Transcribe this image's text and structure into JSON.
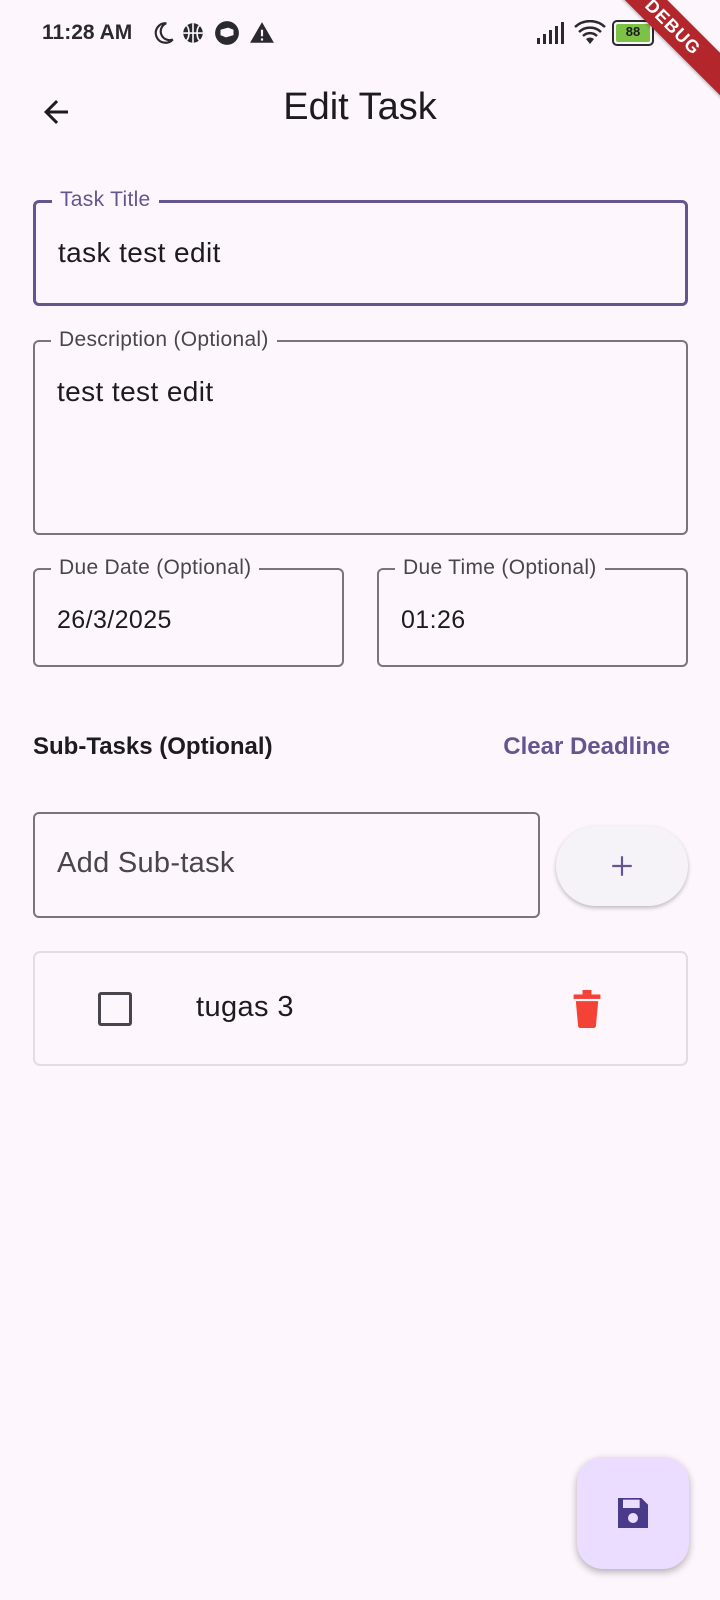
{
  "status_bar": {
    "time": "11:28 AM",
    "battery": "88"
  },
  "debug_banner": "DEBUG",
  "app_bar": {
    "title": "Edit Task",
    "back_icon": "arrow-back-icon"
  },
  "form": {
    "task_title": {
      "label": "Task Title",
      "value": "task test edit"
    },
    "description": {
      "label": "Description (Optional)",
      "value": "test test edit"
    },
    "due_date": {
      "label": "Due Date (Optional)",
      "value": "26/3/2025"
    },
    "due_time": {
      "label": "Due Time (Optional)",
      "value": "01:26"
    }
  },
  "subtasks": {
    "title": "Sub-Tasks (Optional)",
    "clear_deadline": "Clear Deadline",
    "add_placeholder": "Add Sub-task",
    "items": [
      {
        "label": "tugas 3",
        "checked": false
      }
    ]
  },
  "colors": {
    "primary": "#65558f",
    "background": "#fdf7fd",
    "delete": "#f44336",
    "fab": "#eaddff"
  }
}
